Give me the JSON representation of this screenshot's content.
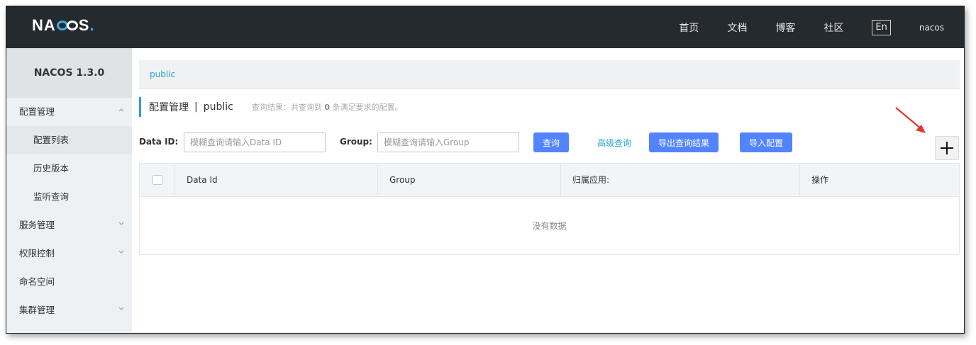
{
  "header": {
    "logo_text_1": "NA",
    "logo_text_2": "S",
    "logo_dot": ".",
    "nav": [
      "首页",
      "文档",
      "博客",
      "社区"
    ],
    "lang": "En",
    "user": "nacos"
  },
  "sidebar": {
    "version": "NACOS 1.3.0",
    "items": [
      {
        "label": "配置管理",
        "type": "group",
        "chevron": "^"
      },
      {
        "label": "配置列表",
        "type": "sub",
        "active": true
      },
      {
        "label": "历史版本",
        "type": "sub"
      },
      {
        "label": "监听查询",
        "type": "sub"
      },
      {
        "label": "服务管理",
        "type": "group",
        "chevron": "v"
      },
      {
        "label": "权限控制",
        "type": "group",
        "chevron": "v"
      },
      {
        "label": "命名空间",
        "type": "group"
      },
      {
        "label": "集群管理",
        "type": "group",
        "chevron": "v"
      }
    ]
  },
  "namespace": {
    "link": "public"
  },
  "title": {
    "main": "配置管理",
    "sep": "|",
    "namespace": "public",
    "summary_pre": "查询结果：共查询到",
    "summary_count": "0",
    "summary_post": "条满足要求的配置。"
  },
  "filters": {
    "dataid_label": "Data ID:",
    "dataid_placeholder": "模糊查询请输入Data ID",
    "group_label": "Group:",
    "group_placeholder": "模糊查询请输入Group",
    "query_button": "查询",
    "advanced_link": "高级查询",
    "export_button": "导出查询结果",
    "import_button": "导入配置"
  },
  "table": {
    "columns": [
      "Data Id",
      "Group",
      "归属应用:",
      "操作"
    ],
    "empty_text": "没有数据"
  },
  "colors": {
    "topbar": "#252a2f",
    "primary": "#5384ff",
    "link": "#23a4d6",
    "arrow": "#e0352b"
  },
  "icons": {
    "add": "plus-icon",
    "arrow": "red-arrow-icon"
  }
}
